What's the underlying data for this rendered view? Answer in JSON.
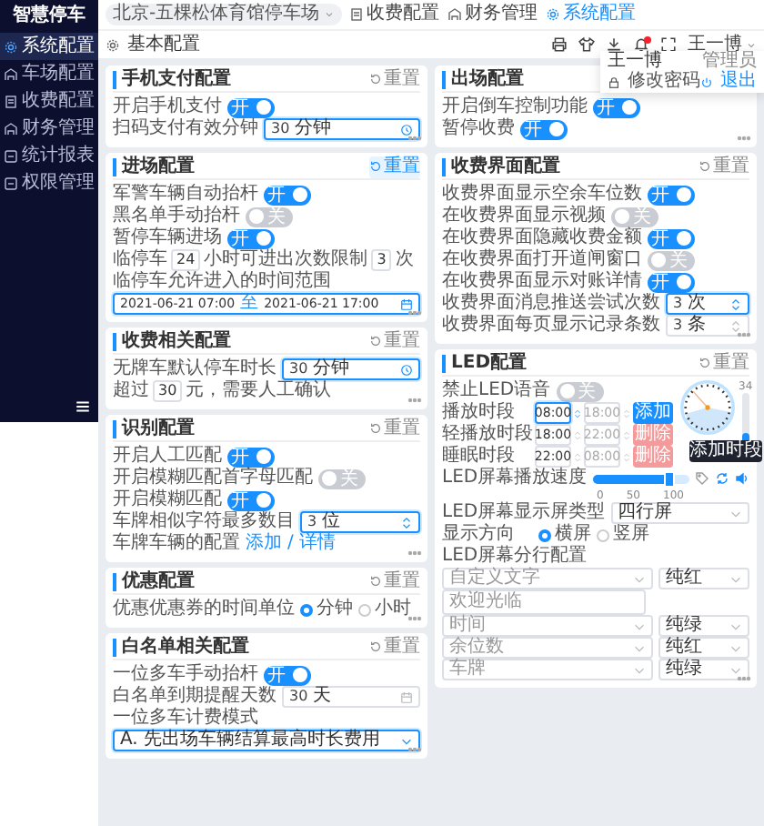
{
  "sidebar": {
    "logo": "智慧停车",
    "items": [
      {
        "label": "系统配置",
        "selected": true
      },
      {
        "label": "车场配置",
        "selected": false
      },
      {
        "label": "收费配置",
        "selected": false
      },
      {
        "label": "财务管理",
        "selected": false
      },
      {
        "label": "统计报表",
        "selected": false
      },
      {
        "label": "权限管理",
        "selected": false
      }
    ]
  },
  "header": {
    "parking_lot": "北京-五棵松体育馆停车场",
    "nav": [
      {
        "label": "收费配置",
        "selected": false
      },
      {
        "label": "财务管理",
        "selected": false
      },
      {
        "label": "系统配置",
        "selected": true
      }
    ],
    "has_unread": true,
    "user": "王一博"
  },
  "user_menu": {
    "name": "王一博",
    "role": "管理员",
    "change_password": "修改密码",
    "logout": "退出"
  },
  "page_tab": "基本配置",
  "left_cards": [
    {
      "title": "手机支付配置",
      "reset": "重置",
      "reset_active": false,
      "rows": [
        {
          "kind": "switch",
          "label": "开启手机支付",
          "on": true,
          "switch_text": "开"
        },
        {
          "kind": "time_field",
          "label": "扫码支付有效分钟",
          "value": "30",
          "unit": "分钟",
          "focused": true
        }
      ]
    },
    {
      "title": "进场配置",
      "reset": "重置",
      "reset_active": true,
      "rows": [
        {
          "kind": "switch",
          "label": "军警车辆自动抬杆",
          "on": true,
          "switch_text": "开"
        },
        {
          "kind": "switch",
          "label": "黑名单手动抬杆",
          "on": false,
          "switch_text": "关"
        },
        {
          "kind": "switch",
          "label": "暂停车辆进场",
          "on": true,
          "switch_text": "开"
        },
        {
          "kind": "inline",
          "parts": [
            {
              "kind": "text",
              "text": "临停车"
            },
            {
              "kind": "input",
              "text": "24"
            },
            {
              "kind": "text",
              "text": "小时可进出次数限制"
            },
            {
              "kind": "input",
              "text": "3"
            },
            {
              "kind": "text",
              "text": "次"
            }
          ]
        },
        {
          "kind": "range",
          "label": "临停车允许进入的时间范围",
          "start": "2021-06-21 07:00",
          "separator": "至",
          "end": "2021-06-21 17:00",
          "focused": true
        }
      ]
    },
    {
      "title": "收费相关配置",
      "reset": "重置",
      "reset_active": false,
      "rows": [
        {
          "kind": "time_field",
          "label": "无牌车默认停车时长",
          "value": "30",
          "unit": "分钟",
          "focused": true
        },
        {
          "kind": "inline",
          "parts": [
            {
              "kind": "text",
              "text": "超过"
            },
            {
              "kind": "input",
              "text": "30"
            },
            {
              "kind": "text",
              "text": "元，需要人工确认"
            }
          ]
        }
      ]
    },
    {
      "title": "识别配置",
      "reset": "重置",
      "reset_active": false,
      "rows": [
        {
          "kind": "switch",
          "label": "开启人工匹配",
          "on": true,
          "switch_text": "开"
        },
        {
          "kind": "switch",
          "label": "开启模糊匹配首字母匹配",
          "on": false,
          "switch_text": "关"
        },
        {
          "kind": "switch",
          "label": "开启模糊匹配",
          "on": true,
          "switch_text": "开"
        },
        {
          "kind": "number_field",
          "label": "车牌相似字符最多数目",
          "value": "3",
          "unit": "位",
          "focused": true
        },
        {
          "kind": "links",
          "label": "车牌车辆的配置",
          "links": [
            "添加",
            "详情"
          ],
          "separator": "/"
        }
      ]
    },
    {
      "title": "优惠配置",
      "reset": "重置",
      "reset_active": false,
      "rows": [
        {
          "kind": "radio",
          "label": "优惠优惠券的时间单位",
          "options": [
            {
              "label": "分钟",
              "selected": true
            },
            {
              "label": "小时",
              "selected": false
            }
          ]
        }
      ]
    },
    {
      "title": "白名单相关配置",
      "reset": "重置",
      "reset_active": false,
      "rows": [
        {
          "kind": "switch",
          "label": "一位多车手动抬杆",
          "on": true,
          "switch_text": "开"
        },
        {
          "kind": "date_field",
          "label": "白名单到期提醒天数",
          "value": "30",
          "unit": "天",
          "focused": false
        },
        {
          "kind": "select_block",
          "label": "一位多车计费模式",
          "value": "A. 先出场车辆结算最高时长费用",
          "focused": true
        }
      ]
    }
  ],
  "right_cards": [
    {
      "title": "出场配置",
      "rows": [
        {
          "kind": "switch",
          "label": "开启倒车控制功能",
          "on": true,
          "switch_text": "开"
        },
        {
          "kind": "switch",
          "label": "暂停收费",
          "on": true,
          "switch_text": "开"
        }
      ]
    },
    {
      "title": "收费界面配置",
      "reset": "重置",
      "reset_active": false,
      "rows": [
        {
          "kind": "switch",
          "label": "收费界面显示空余车位数",
          "on": true,
          "switch_text": "开"
        },
        {
          "kind": "switch",
          "label": "在收费界面显示视频",
          "on": false,
          "switch_text": "关"
        },
        {
          "kind": "switch",
          "label": "在收费界面隐藏收费金额",
          "on": true,
          "switch_text": "开"
        },
        {
          "kind": "switch",
          "label": "在收费界面打开道闸窗口",
          "on": false,
          "switch_text": "关"
        },
        {
          "kind": "switch",
          "label": "在收费界面显示对账详情",
          "on": true,
          "switch_text": "开"
        },
        {
          "kind": "number_field",
          "label": "收费界面消息推送尝试次数",
          "value": "3",
          "unit": "次",
          "focused": true
        },
        {
          "kind": "number_field",
          "label": "收费界面每页显示记录条数",
          "value": "3",
          "unit": "条",
          "focused": false
        }
      ]
    }
  ],
  "led": {
    "title": "LED配置",
    "reset": "重置",
    "reset_active": false,
    "mute": {
      "label": "禁止LED语音",
      "on": false,
      "switch_text": "关"
    },
    "periods": [
      {
        "kind": "add",
        "label": "播放时段",
        "start": "08:00",
        "end": "18:00",
        "start_focused": true,
        "action": "添加"
      },
      {
        "kind": "delete",
        "label": "轻播放时段",
        "start": "18:00",
        "end": "22:00",
        "start_focused": false,
        "action": "删除"
      },
      {
        "kind": "delete",
        "label": "睡眠时段",
        "start": "22:00",
        "end": "08:00",
        "start_focused": false,
        "action": "删除"
      }
    ],
    "volume": {
      "reading": "34",
      "level": 0.34
    },
    "tooltip": "添加时段",
    "speed": {
      "label": "LED屏幕播放速度",
      "level": 0.8,
      "scale": [
        "0",
        "50",
        "100"
      ]
    },
    "screen_type": {
      "label": "LED屏幕显示屏类型",
      "value": "四行屏"
    },
    "direction": {
      "label": "显示方向",
      "options": [
        {
          "label": "横屏",
          "selected": true
        },
        {
          "label": "竖屏",
          "selected": false
        }
      ]
    },
    "lines": {
      "label": "LED屏幕分行配置",
      "items": [
        {
          "kind": "select",
          "content": "自定义文字",
          "text_color": "纯红"
        },
        {
          "kind": "textarea",
          "content": "欢迎光临"
        },
        {
          "kind": "select",
          "content": "时间",
          "text_color": "纯绿"
        },
        {
          "kind": "select",
          "content": "余位数",
          "text_color": "纯红"
        },
        {
          "kind": "select",
          "content": "车牌",
          "text_color": "纯绿"
        }
      ]
    }
  }
}
